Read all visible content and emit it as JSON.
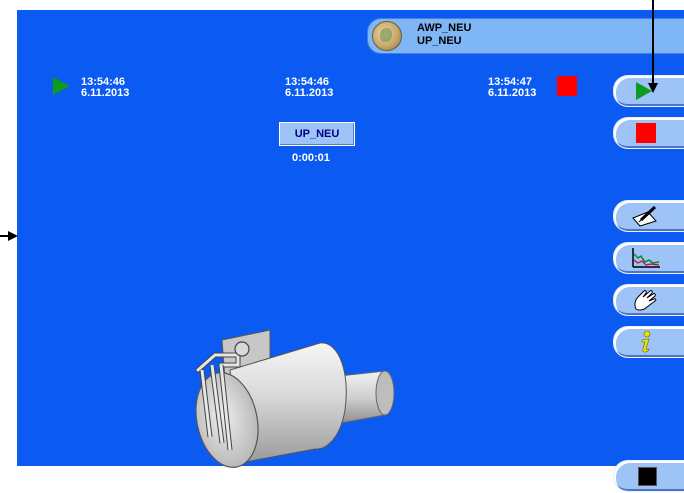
{
  "header": {
    "project_name": "AWP_NEU",
    "program_name": "UP_NEU",
    "avatar_icon": "globe-avatar-icon"
  },
  "timestamps": {
    "start": {
      "time": "13:54:46",
      "date": "6.11.2013",
      "icon": "play-icon"
    },
    "step": {
      "time": "13:54:46",
      "date": "6.11.2013"
    },
    "end": {
      "time": "13:54:47",
      "date": "6.11.2013",
      "icon": "stop-icon"
    }
  },
  "step": {
    "name": "UP_NEU",
    "elapsed": "0:00:01"
  },
  "side_buttons": [
    {
      "name": "play-button",
      "icon": "play-icon"
    },
    {
      "name": "stop-button",
      "icon": "stop-icon"
    },
    {
      "name": "edit-button",
      "icon": "pen-paper-icon"
    },
    {
      "name": "chart-button",
      "icon": "chart-curve-icon"
    },
    {
      "name": "manual-button",
      "icon": "hand-icon"
    },
    {
      "name": "info-button",
      "icon": "info-icon"
    },
    {
      "name": "exit-button",
      "icon": "black-square-icon"
    }
  ],
  "colors": {
    "background": "#0b5bf2",
    "button": "#9ec3f6",
    "play": "#0d9b1f",
    "stop": "#ff0000"
  }
}
